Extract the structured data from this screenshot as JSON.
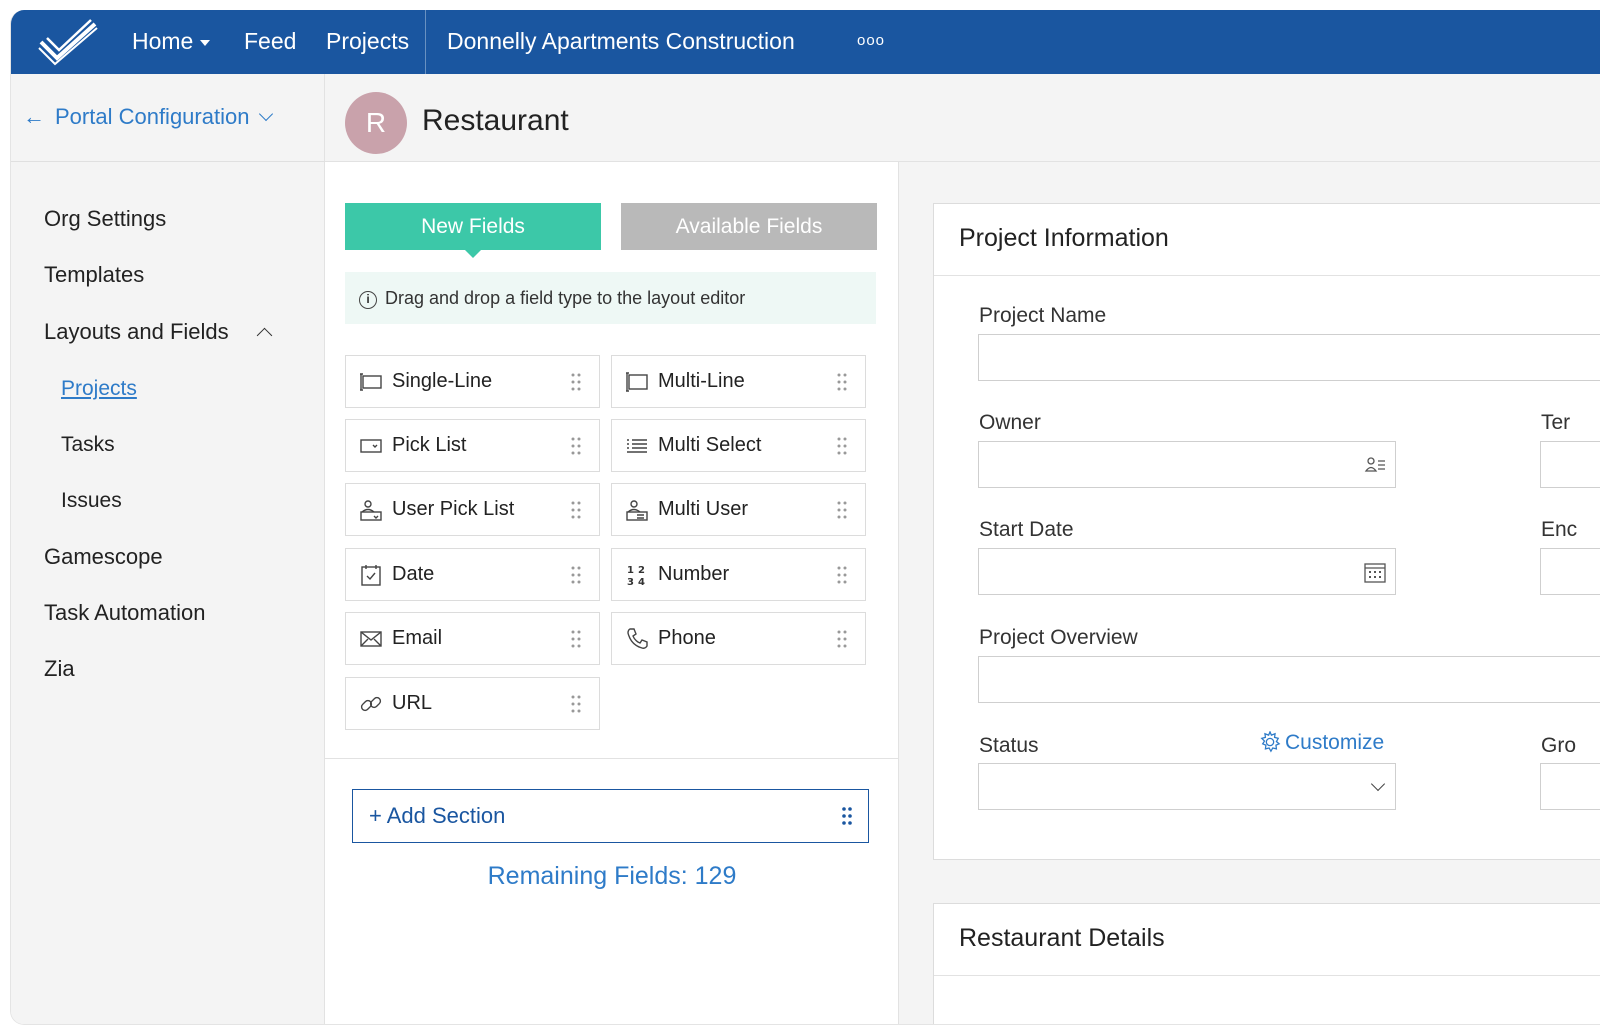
{
  "topbar": {
    "nav": {
      "home": "Home",
      "feed": "Feed",
      "projects": "Projects",
      "portal": "Donnelly Apartments Construction",
      "more": "ooo"
    },
    "color": "#1a56a0"
  },
  "sidebar": {
    "back_label": "Portal Configuration",
    "items": [
      {
        "label": "Org Settings"
      },
      {
        "label": "Templates"
      },
      {
        "label": "Layouts and Fields",
        "expanded": true
      },
      {
        "label": "Projects",
        "sub": true,
        "active": true
      },
      {
        "label": "Tasks",
        "sub": true
      },
      {
        "label": "Issues",
        "sub": true
      },
      {
        "label": "Gamescope"
      },
      {
        "label": "Task Automation"
      },
      {
        "label": "Zia"
      }
    ]
  },
  "layout": {
    "avatar_letter": "R",
    "avatar_color": "#c9a2ab",
    "title": "Restaurant"
  },
  "palette": {
    "tabs": {
      "new": "New Fields",
      "available": "Available Fields"
    },
    "tab_colors": {
      "new": "#3cc8a8",
      "available": "#b9b9b9"
    },
    "hint": "Drag and drop a field type to the layout editor",
    "fields": [
      {
        "label": "Single-Line",
        "icon": "single-line-icon"
      },
      {
        "label": "Multi-Line",
        "icon": "multi-line-icon"
      },
      {
        "label": "Pick List",
        "icon": "pick-list-icon"
      },
      {
        "label": "Multi Select",
        "icon": "multi-select-icon"
      },
      {
        "label": "User Pick List",
        "icon": "user-pick-list-icon"
      },
      {
        "label": "Multi User",
        "icon": "multi-user-icon"
      },
      {
        "label": "Date",
        "icon": "date-icon"
      },
      {
        "label": "Number",
        "icon": "number-icon"
      },
      {
        "label": "Email",
        "icon": "email-icon"
      },
      {
        "label": "Phone",
        "icon": "phone-icon"
      },
      {
        "label": "URL",
        "icon": "url-icon"
      }
    ],
    "add_section": "+ Add Section",
    "remaining": "Remaining Fields: 129"
  },
  "editor": {
    "sections": [
      {
        "title": "Project Information",
        "fields": {
          "project_name": "Project Name",
          "owner": "Owner",
          "template_partial": "Ter",
          "start_date": "Start Date",
          "end_partial": "Enc",
          "overview": "Project Overview",
          "status": "Status",
          "group_partial": "Gro"
        },
        "customize": "Customize"
      },
      {
        "title": "Restaurant Details"
      }
    ]
  }
}
